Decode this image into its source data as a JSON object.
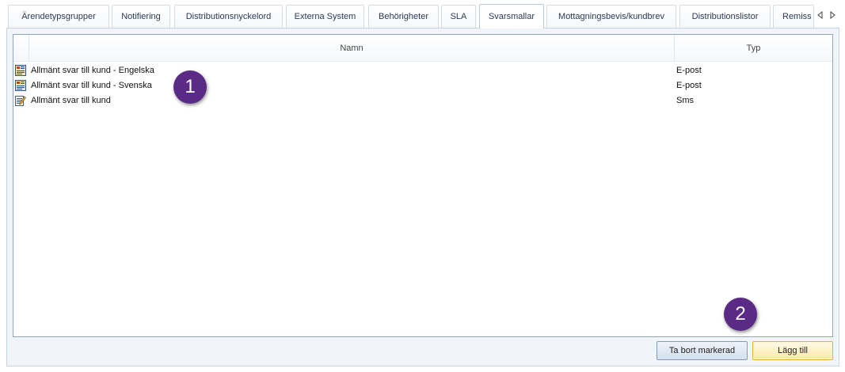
{
  "tabs": [
    {
      "label": "Ärendetypsgrupper"
    },
    {
      "label": "Notifiering"
    },
    {
      "label": "Distributionsnyckelord"
    },
    {
      "label": "Externa System"
    },
    {
      "label": "Behörigheter"
    },
    {
      "label": "SLA"
    },
    {
      "label": "Svarsmallar",
      "active": true
    },
    {
      "label": "Mottagningsbevis/kundbrev"
    },
    {
      "label": "Distributionslistor"
    },
    {
      "label": "Remiss"
    }
  ],
  "tab_scroll": {
    "left_icon": "triangle-left-icon",
    "right_icon": "triangle-right-icon"
  },
  "grid": {
    "columns": {
      "name": "Namn",
      "type": "Typ"
    },
    "rows": [
      {
        "name": "Allmänt svar till kund - Engelska",
        "type": "E-post",
        "icon": "email-template-icon"
      },
      {
        "name": "Allmänt svar till kund - Svenska",
        "type": "E-post",
        "icon": "email-template-icon"
      },
      {
        "name": "Allmänt svar till kund",
        "type": "Sms",
        "icon": "sms-template-icon"
      }
    ]
  },
  "buttons": {
    "remove_label": "Ta bort markerad",
    "add_label": "Lägg till"
  },
  "callouts": {
    "one": "1",
    "two": "2"
  },
  "colors": {
    "callout": "#5b2a86",
    "primary_button_border": "#e0b23c",
    "grid_border": "#8fa4c0"
  }
}
